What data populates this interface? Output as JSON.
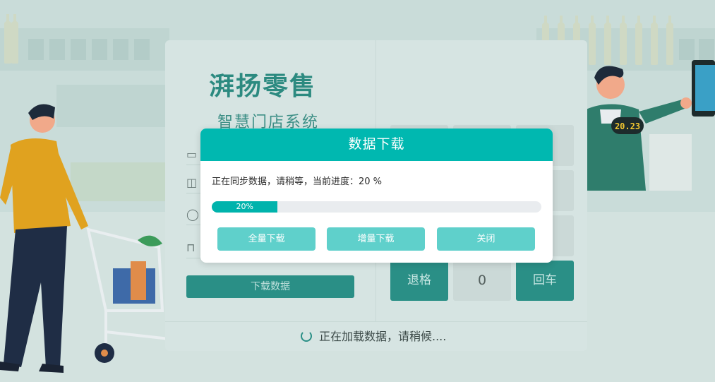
{
  "background": {
    "brand_title": "湃扬零售",
    "brand_subtitle": "智慧门店系统",
    "download_button_label": "下载数据",
    "keypad": {
      "backspace_label": "退格",
      "digit_label": "0",
      "enter_label": "回车"
    },
    "loading_text": "正在加载数据，请稍候....",
    "cashier_display": "20.23"
  },
  "dialog": {
    "title": "数据下载",
    "status_text": "正在同步数据，请稍等，当前进度：20 %",
    "progress": {
      "value": 0.2,
      "label": "20%"
    },
    "buttons": {
      "full_download": "全量下载",
      "incremental_download": "增量下载",
      "close": "关闭"
    }
  },
  "colors": {
    "accent": "#00b8b0",
    "button": "#5fd0cb",
    "progress_fill": "#00b3ac",
    "panel_teal": "#2a8f86"
  }
}
